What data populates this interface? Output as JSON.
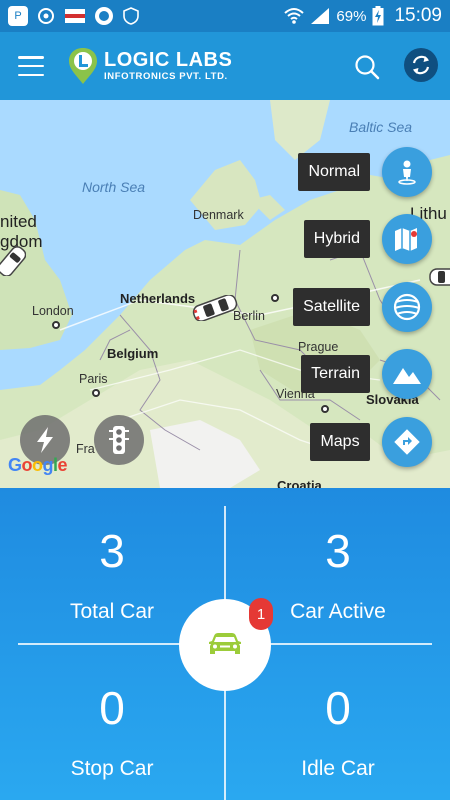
{
  "status_bar": {
    "battery": "69%",
    "time": "15:09"
  },
  "header": {
    "logo_title": "LOGIC LABS",
    "logo_subtitle": "INFOTRONICS PVT. LTD.",
    "menu_icon": "hamburger-menu-icon",
    "search_icon": "search-icon",
    "refresh_icon": "refresh-icon"
  },
  "map": {
    "labels": {
      "baltic_sea": "Baltic Sea",
      "north_sea": "North Sea",
      "united": "nited",
      "kingdom": "gdom",
      "denmark": "Denmark",
      "lithuania": "Lithu",
      "netherlands": "Netherlands",
      "berlin": "Berlin",
      "london": "London",
      "belgium": "Belgium",
      "paris": "Paris",
      "prague": "Prague",
      "vienna": "Vienna",
      "slovakia": "Slovakia",
      "france": "Fra",
      "croatia": "Croatia",
      "google": "Google"
    },
    "map_types": [
      {
        "label": "Normal",
        "icon": "person-pin-icon"
      },
      {
        "label": "Hybrid",
        "icon": "folded-map-icon"
      },
      {
        "label": "Satellite",
        "icon": "globe-icon"
      },
      {
        "label": "Terrain",
        "icon": "mountains-icon"
      },
      {
        "label": "Maps",
        "icon": "directions-icon"
      }
    ],
    "bottom_buttons": [
      "flash-icon",
      "traffic-light-icon"
    ]
  },
  "dashboard": {
    "total_car": {
      "value": "3",
      "label": "Total Car"
    },
    "car_active": {
      "value": "3",
      "label": "Car Active"
    },
    "stop_car": {
      "value": "0",
      "label": "Stop Car"
    },
    "idle_car": {
      "value": "0",
      "label": "Idle Car"
    },
    "badge": "1"
  },
  "colors": {
    "primary": "#2196d9",
    "status_bar": "#1a7fc4",
    "fab": "#3a9fde",
    "badge": "#e53935",
    "car_icon": "#9ccc3a"
  }
}
